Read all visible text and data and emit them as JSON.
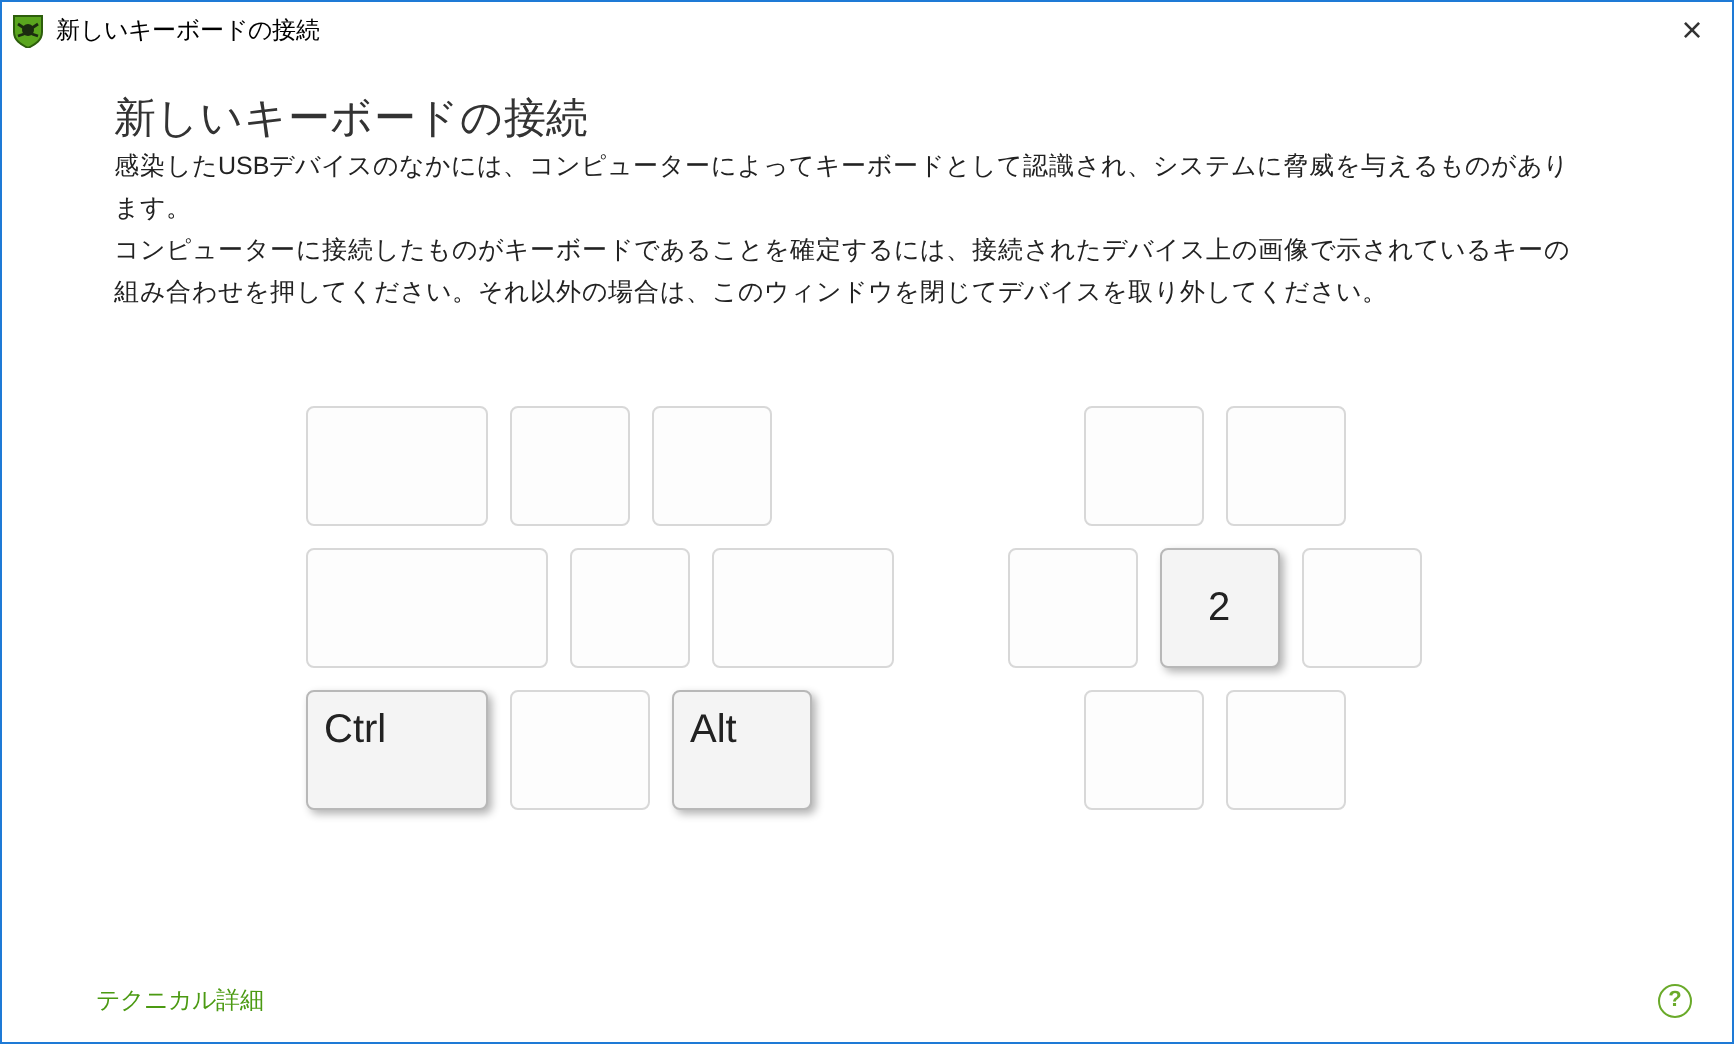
{
  "window": {
    "title": "新しいキーボードの接続",
    "close": "×"
  },
  "heading": "新しいキーボードの接続",
  "paragraphs": [
    "感染したUSBデバイスのなかには、コンピューターによってキーボードとして認識され、システムに脅威を与えるものがあります。",
    "コンピューターに接続したものがキーボードであることを確定するには、接続されたデバイス上の画像で示されているキーの組み合わせを押してください。それ以外の場合は、このウィンドウを閉じてデバイスを取り外してください。"
  ],
  "keyboard": {
    "left_rows": [
      [
        {
          "kind": "wide",
          "highlighted": false
        },
        {
          "kind": "narrow",
          "highlighted": false
        },
        {
          "kind": "narrow",
          "highlighted": false
        }
      ],
      [
        {
          "kind": "extra-wide",
          "highlighted": false
        },
        {
          "kind": "narrow",
          "highlighted": false
        },
        {
          "kind": "wide",
          "highlighted": false
        }
      ],
      [
        {
          "kind": "wide",
          "highlighted": true,
          "label": "Ctrl"
        },
        {
          "kind": "regular",
          "highlighted": false
        },
        {
          "kind": "regular",
          "highlighted": true,
          "label": "Alt"
        }
      ]
    ],
    "right_rows": [
      [
        {
          "kind": "narrow",
          "highlighted": false
        },
        {
          "kind": "narrow",
          "highlighted": false
        }
      ],
      [
        {
          "kind": "medium",
          "highlighted": false
        },
        {
          "kind": "narrow",
          "highlighted": true,
          "label": "2"
        },
        {
          "kind": "narrow",
          "highlighted": false
        }
      ],
      [
        {
          "kind": "narrow",
          "highlighted": false
        },
        {
          "kind": "narrow",
          "highlighted": false
        }
      ]
    ]
  },
  "footer": {
    "link": "テクニカル詳細",
    "help": "?"
  }
}
